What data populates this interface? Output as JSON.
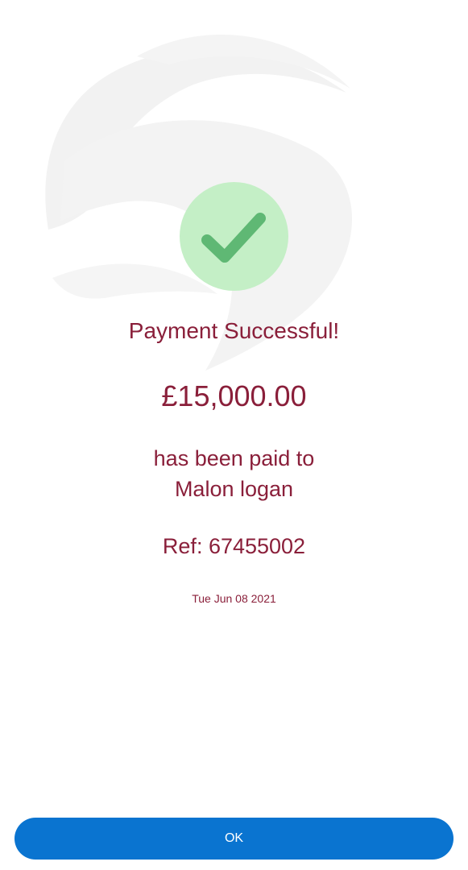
{
  "confirmation": {
    "title": "Payment Successful!",
    "amount": "£15,000.00",
    "paid_to_line": "has been paid to",
    "recipient": "Malon logan",
    "reference": "Ref: 67455002",
    "date": "Tue Jun 08 2021"
  },
  "actions": {
    "ok_label": "OK"
  },
  "colors": {
    "text_accent": "#8a1f3a",
    "success_circle": "#c4efc6",
    "checkmark": "#5fb874",
    "button": "#0a74d0",
    "watermark": "#f3f3f3"
  },
  "icons": {
    "success": "checkmark-icon",
    "watermark": "eagle-logo-watermark"
  }
}
